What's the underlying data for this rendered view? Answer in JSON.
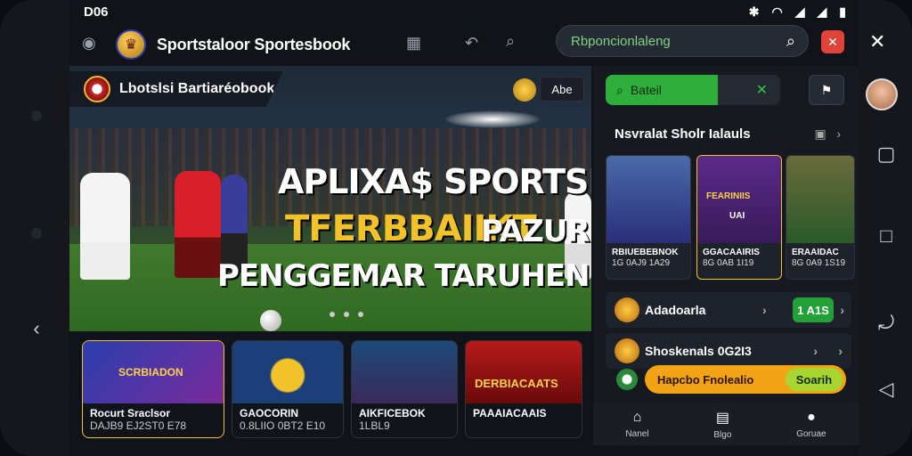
{
  "status_bar": {
    "time": "D06",
    "icons": [
      "bluetooth-icon",
      "wifi-icon",
      "signal-icon",
      "signal-icon",
      "battery-icon"
    ]
  },
  "header": {
    "brand_title": "Sportstaloor Sportesbook",
    "search_placeholder": "Rbponcionlaleng"
  },
  "hero": {
    "banner_label": "Lbotslsi Bartiaréobook",
    "badge_label": "Abe",
    "headline_1": "APLIXA$ SPORTSBOOK",
    "headline_2": "TFERBBAIIKT",
    "headline_3": "PAZUR",
    "headline_4": "PENGGEMAR TARUHEN"
  },
  "game_cards": [
    {
      "art_label": "SCRBIADON",
      "title": "Rocurt Sraclsor",
      "subtitle": "DAJB9 EJ2ST0 E78"
    },
    {
      "title": "GAOCORIN",
      "subtitle": "0.8LIIO 0BT2 E10"
    },
    {
      "title": "AIKFICEBOK",
      "subtitle": "1LBL9"
    },
    {
      "art_label": "DERBIACAATS",
      "title": "PAAAIACAAIS",
      "subtitle": ""
    }
  ],
  "side": {
    "search_value": "Bateil",
    "section_title": "Nsvralat Sholr Ialauls",
    "mini_cards": [
      {
        "label": "RBIUEBEBNOK",
        "sub": "1G 0AJ9 1A29"
      },
      {
        "art_label": "FEARINIIS",
        "badge": "UAI",
        "label": "GGACAAIRIS",
        "sub": "8G 0AB 1I19"
      },
      {
        "label": "ERAAIDAC",
        "sub": "8G 0A9 1S19"
      }
    ],
    "row_1": {
      "label": "Adadoarla",
      "pill": "1 A1S"
    },
    "row_2": {
      "label": "Shoskenals 0G2I3"
    },
    "orange_bar": {
      "label": "Hapcbo Fnolealio",
      "button": "Soarih"
    }
  },
  "bottom_nav": [
    {
      "icon": "home-icon",
      "label": "Nanel"
    },
    {
      "icon": "chart-icon",
      "label": "Blgo"
    },
    {
      "icon": "user-icon",
      "label": "Goruae"
    }
  ],
  "colors": {
    "accent_green": "#2fae3c",
    "accent_orange": "#f2a315",
    "gold": "#f2c22a",
    "red": "#e0433a"
  }
}
